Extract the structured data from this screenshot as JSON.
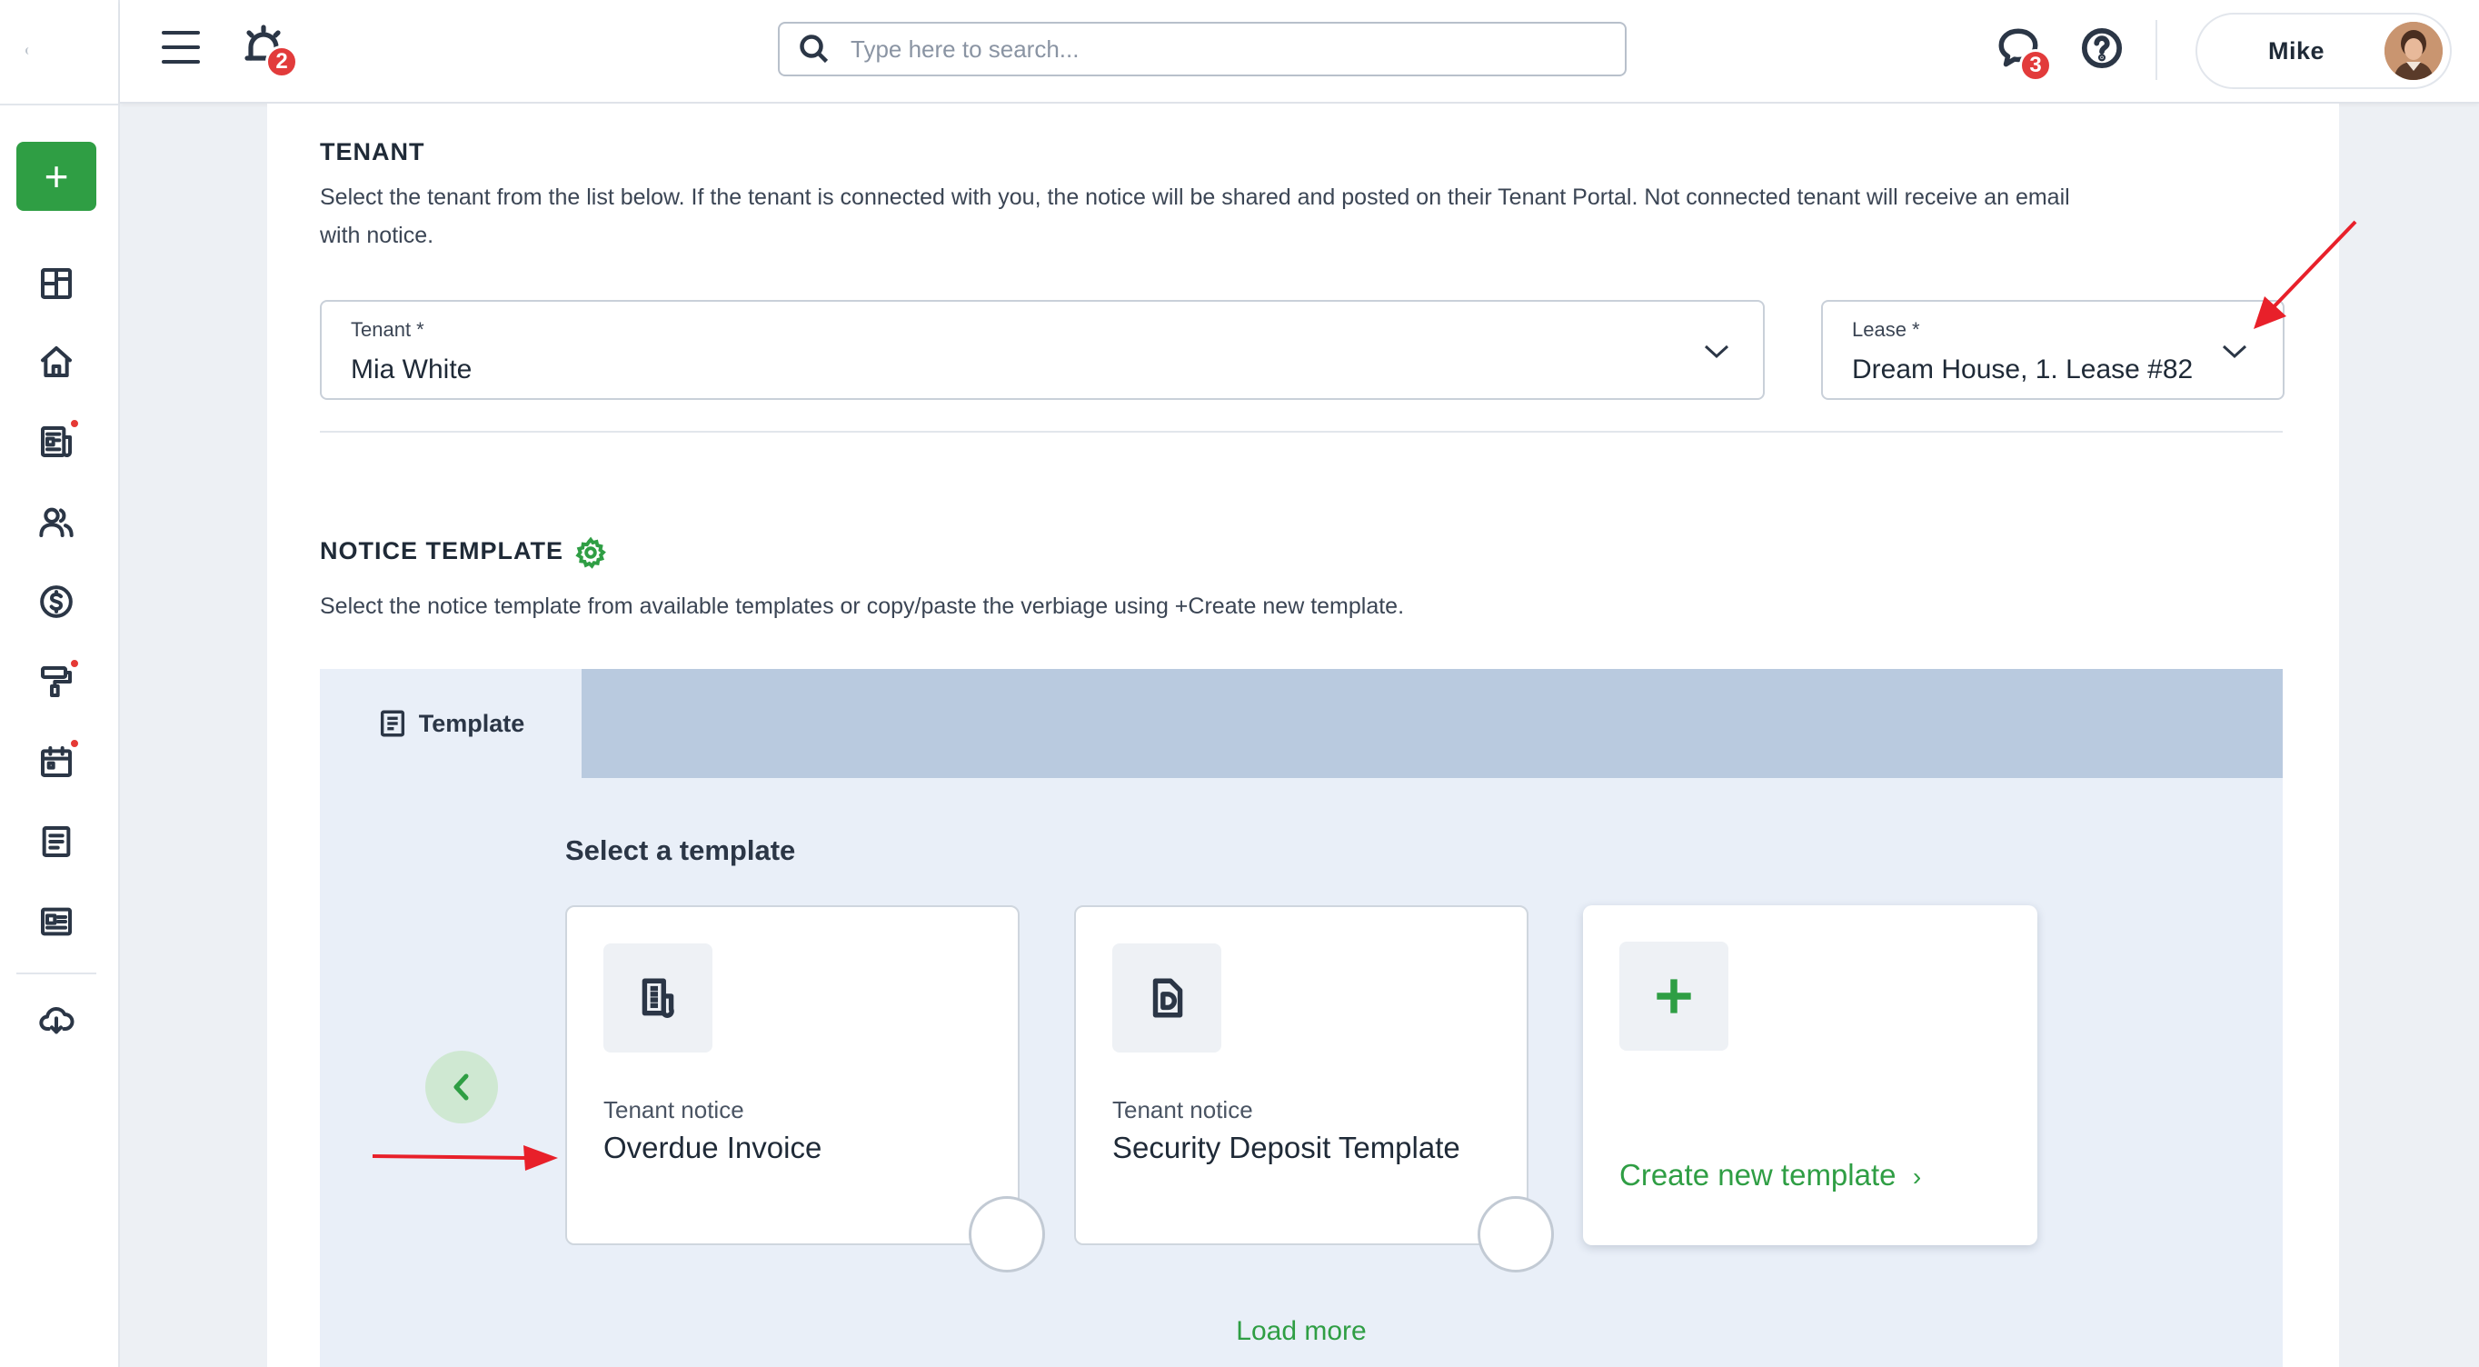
{
  "header": {
    "search_placeholder": "Type here to search...",
    "notifications_count": "2",
    "messages_count": "3",
    "user_name": "Mike"
  },
  "icons": {
    "menu": "hamburger-icon",
    "notifications": "bell-alert-icon",
    "search": "search-icon",
    "messages": "chat-bubble-icon",
    "help": "question-circle-icon"
  },
  "sidebar": {
    "add_label": "+",
    "items": [
      {
        "icon": "dashboard-icon",
        "has_dot": false
      },
      {
        "icon": "home-icon",
        "has_dot": false
      },
      {
        "icon": "document-list-icon",
        "has_dot": true
      },
      {
        "icon": "people-icon",
        "has_dot": false
      },
      {
        "icon": "dollar-circle-icon",
        "has_dot": false
      },
      {
        "icon": "paint-roller-icon",
        "has_dot": true
      },
      {
        "icon": "calendar-icon",
        "has_dot": true
      },
      {
        "icon": "notes-icon",
        "has_dot": false
      },
      {
        "icon": "id-card-icon",
        "has_dot": false
      },
      {
        "icon": "cloud-download-icon",
        "has_dot": false
      }
    ]
  },
  "tenant_section": {
    "title": "TENANT",
    "description_line1": "Select the tenant from the list below. If the tenant is connected with you, the notice will be shared and posted on their Tenant Portal. Not connected tenant will receive an email",
    "description_line2": "with notice.",
    "tenant_field": {
      "label": "Tenant *",
      "value": "Mia White"
    },
    "lease_field": {
      "label": "Lease *",
      "value": "Dream House, 1. Lease #82"
    }
  },
  "notice_template_section": {
    "title": "NOTICE TEMPLATE",
    "description": "Select the notice template from available templates or copy/paste the verbiage using +Create new template.",
    "tab_label": "Template",
    "select_title": "Select a template",
    "templates": [
      {
        "category": "Tenant notice",
        "name": "Overdue Invoice",
        "icon": "invoice-document-icon"
      },
      {
        "category": "Tenant notice",
        "name": "Security Deposit Template",
        "icon": "deposit-document-icon"
      }
    ],
    "create_label": "Create new template",
    "create_chevron": "›",
    "load_more": "Load more"
  },
  "colors": {
    "accent_green": "#2f9e44",
    "badge_red": "#e23b3b",
    "tab_bar": "#b9cadf",
    "panel_bg": "#e9eff8",
    "annotation_arrow": "#e8202a"
  }
}
